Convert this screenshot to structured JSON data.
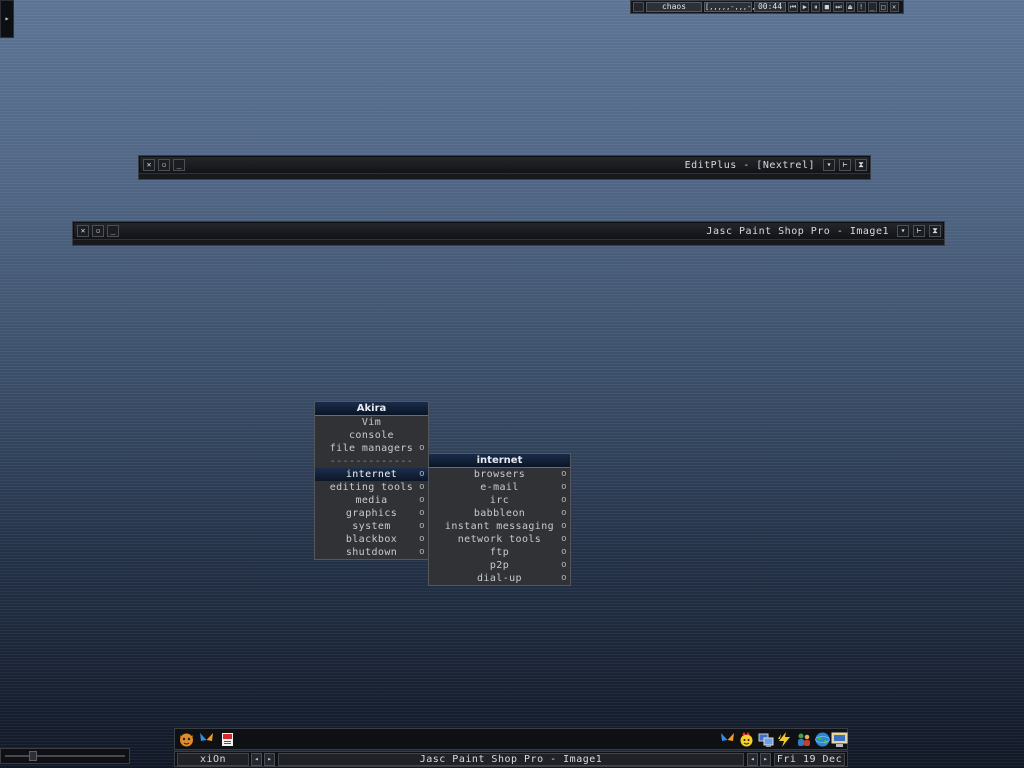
{
  "corner": {
    "arrow": "▸"
  },
  "toolbar": {
    "workspace_label": "chaos",
    "progress_text": "[,,,,,-,,,-,,]",
    "time": "00:44",
    "buttons": [
      "⏮",
      "▶",
      "⏸",
      "■",
      "⏭",
      "⏏",
      "!"
    ]
  },
  "windows": [
    {
      "title": "EditPlus - [Nextrel]"
    },
    {
      "title": "Jasc Paint Shop Pro - Image1"
    }
  ],
  "root_menu": {
    "title": "Akira",
    "items": [
      {
        "label": "Vim",
        "submenu": false
      },
      {
        "label": "console",
        "submenu": false
      },
      {
        "label": "file managers",
        "submenu": true
      },
      {
        "label": "-------------",
        "submenu": false
      },
      {
        "label": "internet",
        "submenu": true,
        "active": true
      },
      {
        "label": "editing tools",
        "submenu": true
      },
      {
        "label": "media",
        "submenu": true
      },
      {
        "label": "graphics",
        "submenu": true
      },
      {
        "label": "system",
        "submenu": true
      },
      {
        "label": "blackbox",
        "submenu": true
      },
      {
        "label": "shutdown",
        "submenu": true
      }
    ]
  },
  "sub_menu": {
    "title": "internet",
    "items": [
      {
        "label": "browsers"
      },
      {
        "label": "e-mail"
      },
      {
        "label": "irc"
      },
      {
        "label": "babbleon"
      },
      {
        "label": "instant messaging"
      },
      {
        "label": "network tools"
      },
      {
        "label": "ftp"
      },
      {
        "label": "p2p"
      },
      {
        "label": "dial-up"
      }
    ],
    "submenu_marker": "o"
  },
  "dock": {
    "left_icons": [
      "cat-face-icon",
      "butterfly-icon",
      "red-document-icon"
    ],
    "right_icons": [
      "butterfly-icon",
      "smiley-flame-icon",
      "network-computer-icon",
      "lightning-icon",
      "users-icon",
      "globe-icon",
      "monitor-icon"
    ]
  },
  "taskbar": {
    "workspace": "xiOn",
    "active_task": "Jasc Paint Shop Pro - Image1",
    "date": "Fri 19 Dec",
    "prev_arrow": "◂",
    "next_arrow": "▸"
  },
  "colors": {
    "accent": "#14243f",
    "menu_bg": "#303236",
    "panel_bg": "#0f1014"
  }
}
